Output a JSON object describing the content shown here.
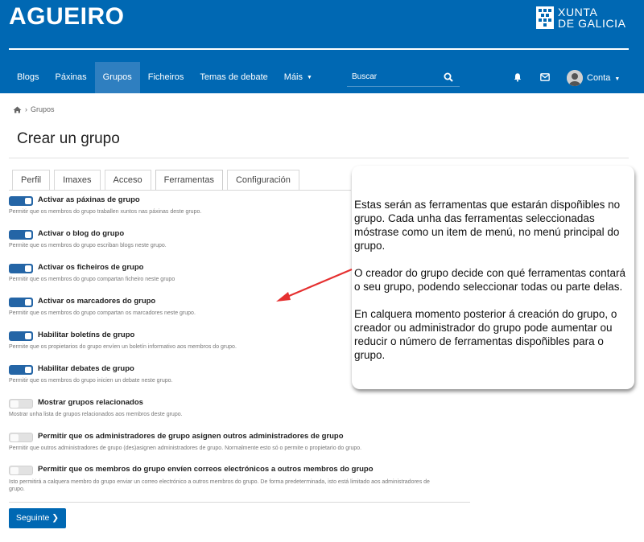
{
  "header": {
    "brand": "AGUEIRO",
    "xunta_line1": "XUNTA",
    "xunta_line2": "DE GALICIA"
  },
  "nav": {
    "items": [
      "Blogs",
      "Páxinas",
      "Grupos",
      "Ficheiros",
      "Temas de debate",
      "Máis"
    ],
    "active": "Grupos",
    "search_placeholder": "Buscar",
    "account_label": "Conta"
  },
  "breadcrumb": {
    "current": "Grupos"
  },
  "page": {
    "title": "Crear un grupo"
  },
  "tabs": [
    "Perfil",
    "Imaxes",
    "Acceso",
    "Ferramentas",
    "Configuración"
  ],
  "active_tab": "Ferramentas",
  "settings": [
    {
      "label": "Activar as páxinas de grupo",
      "desc": "Permitir que os membros do grupo traballen xuntos nas páxinas deste grupo.",
      "enabled": true
    },
    {
      "label": "Activar o blog do grupo",
      "desc": "Permite que os membros do grupo escriban blogs neste grupo.",
      "enabled": true
    },
    {
      "label": "Activar os ficheiros de grupo",
      "desc": "Permitir que os membros do grupo compartan ficheiro neste grupo",
      "enabled": true
    },
    {
      "label": "Activar os marcadores do grupo",
      "desc": "Permitir que os membros do grupo compartan os marcadores neste grupo.",
      "enabled": true
    },
    {
      "label": "Habilitar boletíns de grupo",
      "desc": "Permite que os propietarios do grupo envíen un boletín informativo aos membros do grupo.",
      "enabled": true
    },
    {
      "label": "Habilitar debates de grupo",
      "desc": "Permitir que os membros do grupo inicien un debate neste grupo.",
      "enabled": true
    },
    {
      "label": "Mostrar grupos relacionados",
      "desc": "Mostrar unha lista de grupos relacionados aos membros deste grupo.",
      "enabled": false
    },
    {
      "label": "Permitir que os administradores de grupo asignen outros administradores de grupo",
      "desc": "Permitir que outros administradores de grupo (des)asignen administradores de grupo. Normalmente esto só o permite o propietario do grupo.",
      "enabled": false
    },
    {
      "label": "Permitir que os membros do grupo envíen correos electrónicos a outros membros do grupo",
      "desc": "Isto permitirá a calquera membro do grupo enviar un correo electrónico a outros membros do grupo. De forma predeterminada, isto está limitado aos administradores de grupo.",
      "enabled": false
    }
  ],
  "next_button": "Seguinte",
  "callout": {
    "p1": "Estas serán as ferramentas que estarán dispoñibles no grupo. Cada unha das ferramentas seleccionadas móstrase como un item de menú, no menú principal do grupo.",
    "p2": "O creador do grupo decide con qué ferramentas contará o seu grupo, podendo seleccionar todas ou parte delas.",
    "p3": "En calquera momento posterior á creación do grupo, o creador ou administrador do grupo pode aumentar ou reducir o número de ferramentas dispoñibles para o grupo."
  },
  "colors": {
    "header": "#0068b3",
    "toggle_on": "#2465a6",
    "arrow": "#e53030"
  }
}
